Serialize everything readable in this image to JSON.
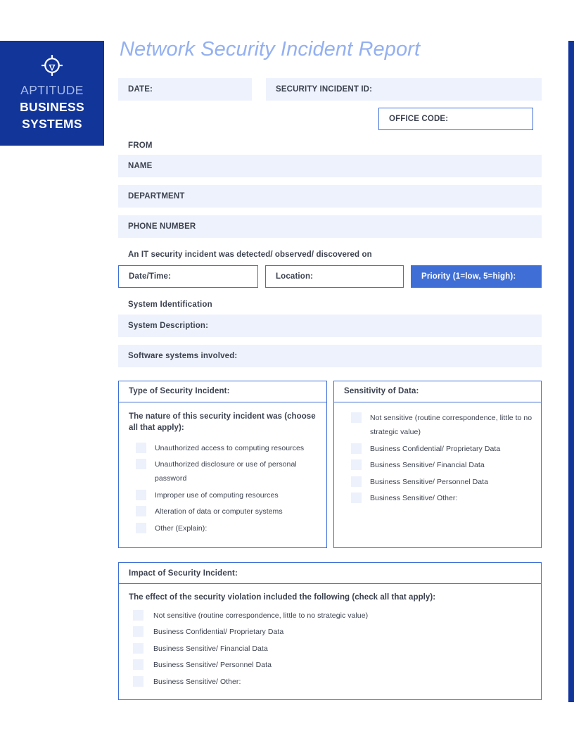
{
  "brand": {
    "logo_icon": "crosshair-target-icon",
    "line1": "APTITUDE",
    "line2": "BUSINESS",
    "line3": "SYSTEMS",
    "bg_color": "#12359A",
    "line1_color": "#A8BCEA",
    "line2_color": "#FFFFFF"
  },
  "accent": {
    "rail_color": "#12359A",
    "border_blue": "#3F6FD6",
    "fill_blue": "#EEF2FC",
    "checkbox_blue": "#EDF1FB",
    "title_blue": "#94B0F0",
    "priority_fill": "#3F6FD6"
  },
  "document": {
    "title": "Network Security Incident Report"
  },
  "header": {
    "date_label": "DATE:",
    "incident_id_label": "SECURITY INCIDENT ID:",
    "office_code_label": "OFFICE CODE:"
  },
  "from_section": {
    "heading": "FROM",
    "fields": [
      {
        "label": "NAME"
      },
      {
        "label": "DEPARTMENT"
      },
      {
        "label": "PHONE NUMBER"
      }
    ]
  },
  "detection": {
    "statement": "An IT security incident was detected/ observed/ discovered on",
    "date_time_label": "Date/Time:",
    "location_label": "Location:",
    "priority_label": "Priority (1=low, 5=high):"
  },
  "system_identification": {
    "heading": "System Identification",
    "fields": [
      {
        "label": "System Description:"
      },
      {
        "label": "Software systems involved:"
      }
    ]
  },
  "incident_type_panel": {
    "title": "Type of Security Incident:",
    "prompt": "The nature of this security incident was (choose all that apply):",
    "options": [
      "Unauthorized access to computing resources",
      "Unauthorized disclosure or use of personal password",
      "Improper use of computing resources",
      "Alteration of data or computer systems",
      "Other (Explain):"
    ]
  },
  "sensitivity_panel": {
    "title": "Sensitivity of Data:",
    "options": [
      "Not sensitive (routine correspondence, little to no strategic value)",
      "Business Confidential/ Proprietary Data",
      "Business Sensitive/ Financial Data",
      "Business Sensitive/ Personnel Data",
      "Business Sensitive/ Other:"
    ]
  },
  "impact_panel": {
    "title": "Impact of Security Incident:",
    "prompt": "The effect of the security violation included the following (check all that apply):",
    "options": [
      "Not sensitive (routine correspondence, little to no strategic value)",
      "Business Confidential/ Proprietary Data",
      "Business Sensitive/ Financial Data",
      "Business Sensitive/ Personnel Data",
      "Business Sensitive/ Other:"
    ]
  }
}
